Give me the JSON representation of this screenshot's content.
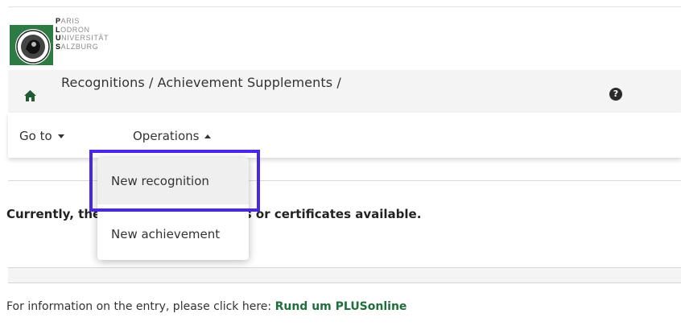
{
  "logo": {
    "lines": [
      {
        "initial": "P",
        "rest": "ARIS"
      },
      {
        "initial": "L",
        "rest": "ODRON"
      },
      {
        "initial": "U",
        "rest": "NIVERSITÄT"
      },
      {
        "initial": "S",
        "rest": "ALZBURG"
      }
    ],
    "icon": "university-seal-icon"
  },
  "breadcrumb": {
    "text": "Recognitions / Achievement Supplements  /",
    "home_icon": "home-icon",
    "help_icon": "help-icon",
    "help_glyph": "?"
  },
  "nav": {
    "goto_label": "Go to",
    "operations_label": "Operations"
  },
  "dropdown": {
    "items": [
      "New recognition",
      "New achievement"
    ]
  },
  "content": {
    "message": "Currently, there are no recognitions or certificates available.",
    "info_prefix": "For information on the entry, please click here: ",
    "info_link": "Rund um PLUSonline"
  },
  "colors": {
    "highlight": "#4a26e6",
    "link": "#1f6e3c",
    "home_icon": "#1f5c33"
  }
}
